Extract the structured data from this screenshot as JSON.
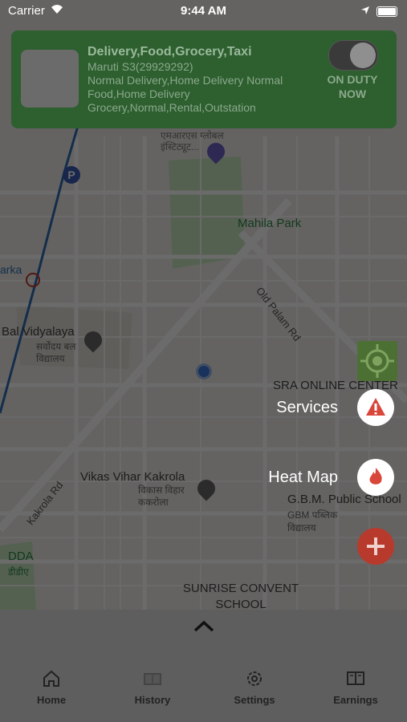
{
  "status_bar": {
    "carrier": "Carrier",
    "time": "9:44 AM"
  },
  "driver_card": {
    "title": "Delivery,Food,Grocery,Taxi",
    "vehicle": "Maruti S3(29929292)",
    "services": "Normal Delivery,Home Delivery Normal Food,Home Delivery Grocery,Normal,Rental,Outstation",
    "duty_status": "ON DUTY NOW"
  },
  "map": {
    "labels": {
      "institute": "एमआरएस ग्लोबल इंस्टिट्यूट...",
      "park": "Mahila Park",
      "road1": "Old Palam Rd",
      "road2": "Kakrola Rd",
      "school1": "Bal Vidyalaya",
      "school1_hi": "सर्वोदय बल विद्यालय",
      "area": "Vikas Vihar Kakrola",
      "area_hi": "विकास विहार ककरोला",
      "sra": "SRA ONLINE CENTER",
      "gbm": "G.B.M. Public School",
      "gbm_hi": "GBM पब्लिक विद्यालय",
      "dda": "DDA",
      "dda_hi": "डीडीए",
      "sunrise": "SUNRISE CONVENT SCHOOL",
      "arka": "arka"
    }
  },
  "fabs": {
    "services_label": "Services",
    "heatmap_label": "Heat Map"
  },
  "nav": {
    "home": "Home",
    "history": "History",
    "settings": "Settings",
    "earnings": "Earnings"
  }
}
